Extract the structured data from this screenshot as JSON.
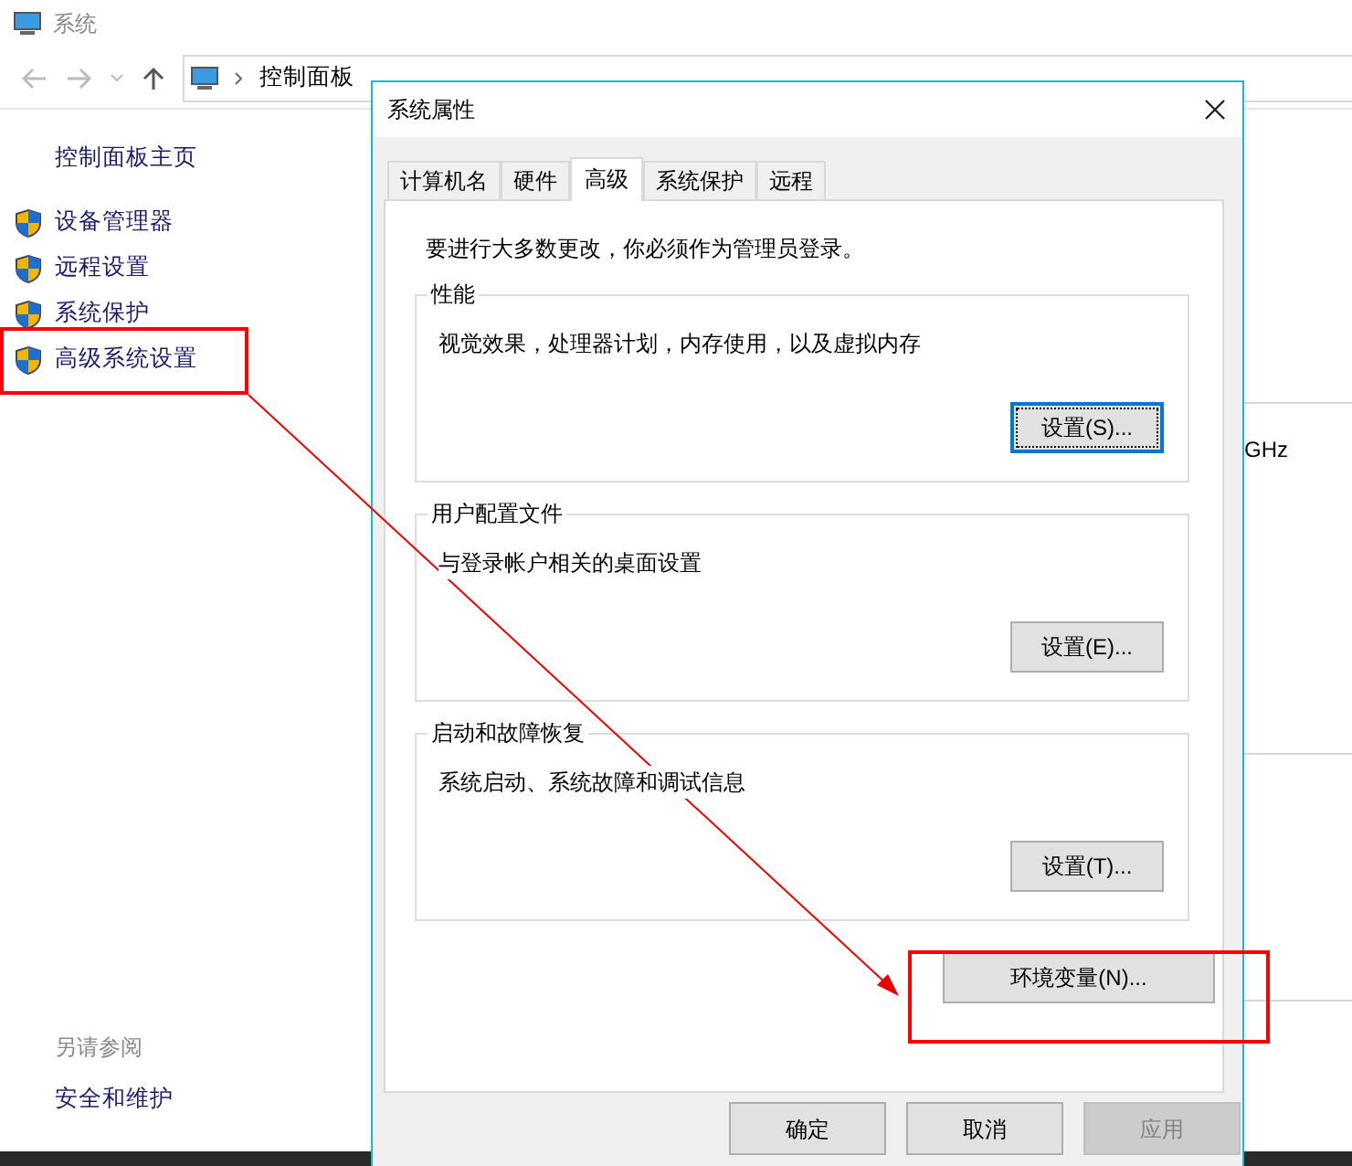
{
  "window": {
    "title": "系统",
    "breadcrumb": [
      "控制面板"
    ],
    "sidebar": {
      "home": "控制面板主页",
      "items": [
        {
          "label": "设备管理器"
        },
        {
          "label": "远程设置"
        },
        {
          "label": "系统保护"
        },
        {
          "label": "高级系统设置"
        }
      ],
      "see_also": {
        "heading": "另请参阅",
        "links": [
          "安全和维护"
        ]
      }
    },
    "right_pane": {
      "fragment": "GHz"
    }
  },
  "dialog": {
    "title": "系统属性",
    "tabs": [
      {
        "label": "计算机名",
        "selected": false
      },
      {
        "label": "硬件",
        "selected": false
      },
      {
        "label": "高级",
        "selected": true
      },
      {
        "label": "系统保护",
        "selected": false
      },
      {
        "label": "远程",
        "selected": false
      }
    ],
    "notice": "要进行大多数更改，你必须作为管理员登录。",
    "groups": [
      {
        "title": "性能",
        "description": "视觉效果，处理器计划，内存使用，以及虚拟内存",
        "button": "设置(S)...",
        "focused": true
      },
      {
        "title": "用户配置文件",
        "description": "与登录帐户相关的桌面设置",
        "button": "设置(E)...",
        "focused": false
      },
      {
        "title": "启动和故障恢复",
        "description": "系统启动、系统故障和调试信息",
        "button": "设置(T)...",
        "focused": false
      }
    ],
    "env_button": "环境变量(N)...",
    "footer_buttons": [
      {
        "label": "确定",
        "disabled": false
      },
      {
        "label": "取消",
        "disabled": false
      },
      {
        "label": "应用",
        "disabled": true
      }
    ]
  }
}
